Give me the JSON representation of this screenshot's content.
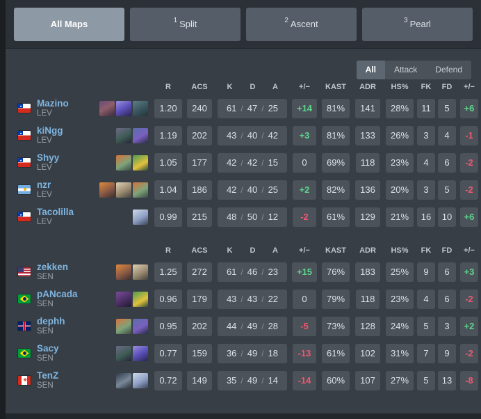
{
  "map_tabs": [
    {
      "label": "All Maps",
      "num": "",
      "active": true
    },
    {
      "label": "Split",
      "num": "1",
      "active": false
    },
    {
      "label": "Ascent",
      "num": "2",
      "active": false
    },
    {
      "label": "Pearl",
      "num": "3",
      "active": false
    }
  ],
  "side_filter": [
    {
      "label": "All",
      "active": true
    },
    {
      "label": "Attack",
      "active": false
    },
    {
      "label": "Defend",
      "active": false
    }
  ],
  "columns": [
    "",
    "",
    "R",
    "ACS",
    "K",
    "D",
    "A",
    "+/−",
    "KAST",
    "ADR",
    "HS%",
    "FK",
    "FD",
    "+/−"
  ],
  "colors": {
    "positive": "#5fd48c",
    "negative": "#f2566f",
    "player_name": "#7fb5e0",
    "cell_bg": "#4b525a",
    "table_bg": "#383e45",
    "tab_bg": "#2b3136",
    "tab_active": "#8e99a6"
  },
  "teams": [
    {
      "name": "LEV",
      "players": [
        {
          "name": "Mazino",
          "team": "LEV",
          "country": "Chile",
          "agents": [
            "agent-skye-dark",
            "agent-omen",
            "agent-harbor"
          ],
          "r": "1.20",
          "acs": "240",
          "k": "61",
          "d": "47",
          "a": "25",
          "pm": "+14",
          "kast": "81%",
          "adr": "141",
          "hs": "28%",
          "fk": "11",
          "fd": "5",
          "fpm": "+6"
        },
        {
          "name": "kiNgg",
          "team": "LEV",
          "country": "Chile",
          "agents": [
            "agent-viper",
            "agent-kayo"
          ],
          "r": "1.19",
          "acs": "202",
          "k": "43",
          "d": "40",
          "a": "42",
          "pm": "+3",
          "kast": "81%",
          "adr": "133",
          "hs": "26%",
          "fk": "3",
          "fd": "4",
          "fpm": "-1"
        },
        {
          "name": "Shyy",
          "team": "LEV",
          "country": "Chile",
          "agents": [
            "agent-skye",
            "agent-killjoy"
          ],
          "r": "1.05",
          "acs": "177",
          "k": "42",
          "d": "42",
          "a": "15",
          "pm": "0",
          "kast": "69%",
          "adr": "118",
          "hs": "23%",
          "fk": "4",
          "fd": "6",
          "fpm": "-2"
        },
        {
          "name": "nzr",
          "team": "LEV",
          "country": "Argentina",
          "agents": [
            "agent-raze",
            "agent-breach",
            "agent-skye"
          ],
          "r": "1.04",
          "acs": "186",
          "k": "42",
          "d": "40",
          "a": "25",
          "pm": "+2",
          "kast": "82%",
          "adr": "136",
          "hs": "20%",
          "fk": "3",
          "fd": "5",
          "fpm": "-2"
        },
        {
          "name": "Tacolilla",
          "team": "LEV",
          "country": "Chile",
          "agents": [
            "agent-jett"
          ],
          "r": "0.99",
          "acs": "215",
          "k": "48",
          "d": "50",
          "a": "12",
          "pm": "-2",
          "kast": "61%",
          "adr": "129",
          "hs": "21%",
          "fk": "16",
          "fd": "10",
          "fpm": "+6"
        }
      ]
    },
    {
      "name": "SEN",
      "players": [
        {
          "name": "zekken",
          "team": "SEN",
          "country": "United States",
          "agents": [
            "agent-raze",
            "agent-breach"
          ],
          "r": "1.25",
          "acs": "272",
          "k": "61",
          "d": "46",
          "a": "23",
          "pm": "+15",
          "kast": "76%",
          "adr": "183",
          "hs": "25%",
          "fk": "9",
          "fd": "6",
          "fpm": "+3"
        },
        {
          "name": "pANcada",
          "team": "SEN",
          "country": "Brazil",
          "agents": [
            "agent-astra",
            "agent-killjoy"
          ],
          "r": "0.96",
          "acs": "179",
          "k": "43",
          "d": "43",
          "a": "22",
          "pm": "0",
          "kast": "79%",
          "adr": "118",
          "hs": "23%",
          "fk": "4",
          "fd": "6",
          "fpm": "-2"
        },
        {
          "name": "dephh",
          "team": "SEN",
          "country": "United Kingdom",
          "agents": [
            "agent-skye",
            "agent-kayo"
          ],
          "r": "0.95",
          "acs": "202",
          "k": "44",
          "d": "49",
          "a": "28",
          "pm": "-5",
          "kast": "73%",
          "adr": "128",
          "hs": "24%",
          "fk": "5",
          "fd": "3",
          "fpm": "+2"
        },
        {
          "name": "Sacy",
          "team": "SEN",
          "country": "Brazil",
          "agents": [
            "agent-viper",
            "agent-omen"
          ],
          "r": "0.77",
          "acs": "159",
          "k": "36",
          "d": "49",
          "a": "18",
          "pm": "-13",
          "kast": "61%",
          "adr": "102",
          "hs": "31%",
          "fk": "7",
          "fd": "9",
          "fpm": "-2"
        },
        {
          "name": "TenZ",
          "team": "SEN",
          "country": "Canada",
          "agents": [
            "agent-sage",
            "agent-jett"
          ],
          "r": "0.72",
          "acs": "149",
          "k": "35",
          "d": "49",
          "a": "14",
          "pm": "-14",
          "kast": "60%",
          "adr": "107",
          "hs": "27%",
          "fk": "5",
          "fd": "13",
          "fpm": "-8"
        }
      ]
    }
  ]
}
